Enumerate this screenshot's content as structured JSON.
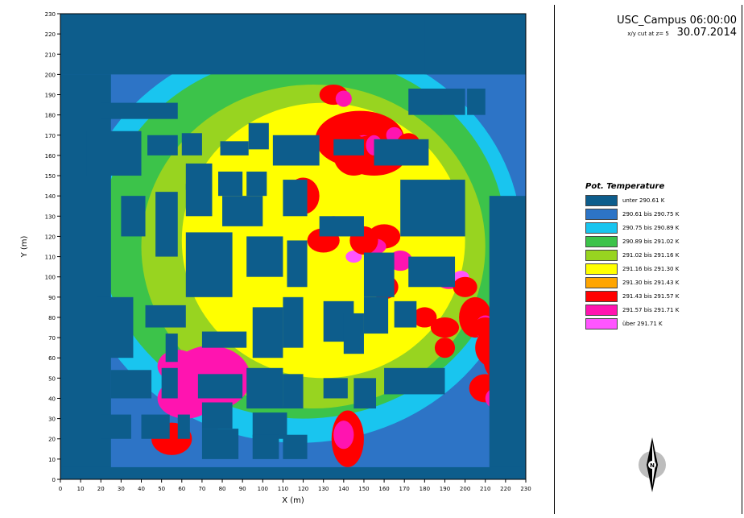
{
  "header": {
    "title": "USC_Campus 06:00:00 30.07.2014",
    "subtitle": "x/y cut at z= 5"
  },
  "legend": {
    "title": "Pot. Temperature",
    "items": [
      {
        "label": "unter 290.61 K",
        "color": "#0d5d8c"
      },
      {
        "label": "290.61 bis 290.75 K",
        "color": "#2d74c6"
      },
      {
        "label": "290.75 bis 290.89 K",
        "color": "#19c5ef"
      },
      {
        "label": "290.89 bis 291.02 K",
        "color": "#3cc34a"
      },
      {
        "label": "291.02 bis 291.16 K",
        "color": "#98d420"
      },
      {
        "label": "291.16 bis 291.30 K",
        "color": "#ffff00"
      },
      {
        "label": "291.30 bis 291.43 K",
        "color": "#ffa500"
      },
      {
        "label": "291.43 bis 291.57 K",
        "color": "#ff0000"
      },
      {
        "label": "291.57 bis 291.71 K",
        "color": "#ff14b0"
      },
      {
        "label": "über 291.71 K",
        "color": "#ff55ff"
      }
    ]
  },
  "north_arrow": {
    "label": "N",
    "icon": "north-arrow-icon"
  },
  "chart_data": {
    "type": "heatmap",
    "title": "USC_Campus 06:00:00 30.07.2014",
    "subtitle": "x/y cut at z= 5",
    "xlabel": "X (m)",
    "ylabel": "Y (m)",
    "xlim": [
      0,
      230
    ],
    "ylim": [
      0,
      230
    ],
    "x_ticks": [
      0,
      10,
      20,
      30,
      40,
      50,
      60,
      70,
      80,
      90,
      100,
      110,
      120,
      130,
      140,
      150,
      160,
      170,
      180,
      190,
      200,
      210,
      220,
      230
    ],
    "y_ticks": [
      0,
      10,
      20,
      30,
      40,
      50,
      60,
      70,
      80,
      90,
      100,
      110,
      120,
      130,
      140,
      150,
      160,
      170,
      180,
      190,
      200,
      210,
      220,
      230
    ],
    "variable": "Pot. Temperature",
    "unit": "K",
    "grid": false,
    "legend_position": "right",
    "buildings": [
      [
        0,
        200,
        230,
        230
      ],
      [
        0,
        0,
        25,
        200
      ],
      [
        180,
        200,
        230,
        230
      ],
      [
        212,
        0,
        230,
        140
      ],
      [
        0,
        0,
        230,
        6
      ],
      [
        172,
        180,
        200,
        193
      ],
      [
        201,
        180,
        210,
        193
      ],
      [
        20,
        178,
        58,
        186
      ],
      [
        13,
        150,
        40,
        172
      ],
      [
        43,
        160,
        58,
        170
      ],
      [
        60,
        160,
        70,
        171
      ],
      [
        79,
        160,
        93,
        167
      ],
      [
        93,
        163,
        103,
        176
      ],
      [
        105,
        155,
        128,
        170
      ],
      [
        135,
        160,
        150,
        168
      ],
      [
        155,
        155,
        182,
        168
      ],
      [
        62,
        143,
        75,
        156
      ],
      [
        78,
        140,
        90,
        152
      ],
      [
        92,
        140,
        102,
        152
      ],
      [
        30,
        120,
        42,
        140
      ],
      [
        47,
        110,
        58,
        142
      ],
      [
        62,
        130,
        75,
        146
      ],
      [
        80,
        125,
        100,
        140
      ],
      [
        110,
        130,
        122,
        148
      ],
      [
        128,
        120,
        150,
        130
      ],
      [
        168,
        120,
        200,
        148
      ],
      [
        62,
        90,
        85,
        122
      ],
      [
        92,
        100,
        110,
        120
      ],
      [
        112,
        95,
        122,
        118
      ],
      [
        150,
        90,
        165,
        112
      ],
      [
        172,
        95,
        195,
        110
      ],
      [
        18,
        60,
        36,
        90
      ],
      [
        42,
        75,
        62,
        86
      ],
      [
        52,
        58,
        58,
        72
      ],
      [
        95,
        60,
        110,
        85
      ],
      [
        110,
        65,
        120,
        90
      ],
      [
        130,
        68,
        145,
        88
      ],
      [
        140,
        62,
        150,
        82
      ],
      [
        150,
        72,
        162,
        90
      ],
      [
        165,
        75,
        176,
        88
      ],
      [
        70,
        65,
        92,
        73
      ],
      [
        25,
        40,
        45,
        54
      ],
      [
        50,
        40,
        58,
        55
      ],
      [
        68,
        40,
        90,
        52
      ],
      [
        92,
        35,
        110,
        55
      ],
      [
        110,
        35,
        120,
        52
      ],
      [
        130,
        40,
        142,
        50
      ],
      [
        145,
        35,
        156,
        50
      ],
      [
        160,
        42,
        190,
        55
      ],
      [
        70,
        25,
        85,
        38
      ],
      [
        95,
        20,
        112,
        33
      ],
      [
        20,
        20,
        35,
        32
      ],
      [
        40,
        20,
        54,
        32
      ],
      [
        58,
        20,
        64,
        32
      ],
      [
        70,
        10,
        88,
        25
      ],
      [
        95,
        10,
        108,
        22
      ],
      [
        110,
        10,
        122,
        22
      ]
    ],
    "hot_spots": [
      [
        40,
        74,
        50,
        20,
        16,
        8
      ],
      [
        48,
        62,
        40,
        14,
        10,
        8
      ],
      [
        52,
        58,
        56,
        10,
        8,
        8
      ],
      [
        20,
        142,
        20,
        8,
        14,
        7
      ],
      [
        21,
        140,
        22,
        5,
        7,
        8
      ],
      [
        15,
        55,
        20,
        10,
        8,
        7
      ],
      [
        120,
        148,
        168,
        22,
        14,
        7
      ],
      [
        123,
        150,
        165,
        6,
        5,
        8
      ],
      [
        112,
        145,
        160,
        10,
        10,
        7
      ],
      [
        150,
        155,
        160,
        16,
        10,
        7
      ],
      [
        156,
        155,
        165,
        4,
        5,
        8
      ],
      [
        162,
        188,
        185,
        6,
        5,
        7
      ],
      [
        162,
        187,
        183,
        3,
        3,
        8
      ],
      [
        102,
        135,
        190,
        7,
        5,
        7
      ],
      [
        108,
        140,
        188,
        4,
        4,
        8
      ],
      [
        145,
        120,
        140,
        8,
        9,
        7
      ],
      [
        145,
        135,
        125,
        5,
        5,
        8
      ],
      [
        140,
        130,
        118,
        8,
        6,
        7
      ],
      [
        175,
        160,
        120,
        8,
        6,
        7
      ],
      [
        185,
        155,
        115,
        6,
        4,
        8
      ],
      [
        192,
        145,
        110,
        4,
        3,
        9
      ],
      [
        200,
        168,
        108,
        6,
        5,
        8
      ],
      [
        196,
        150,
        118,
        7,
        7,
        7
      ],
      [
        190,
        165,
        170,
        4,
        4,
        8
      ],
      [
        180,
        172,
        165,
        6,
        6,
        7
      ],
      [
        170,
        160,
        95,
        7,
        6,
        7
      ],
      [
        220,
        192,
        98,
        6,
        4,
        8
      ],
      [
        230,
        198,
        100,
        4,
        3,
        9
      ],
      [
        155,
        200,
        95,
        6,
        5,
        7
      ],
      [
        158,
        205,
        80,
        8,
        10,
        7
      ],
      [
        160,
        210,
        75,
        5,
        6,
        8
      ],
      [
        160,
        215,
        60,
        6,
        10,
        7
      ],
      [
        165,
        220,
        65,
        4,
        5,
        8
      ],
      [
        180,
        240,
        55,
        4,
        5,
        9
      ],
      [
        95,
        210,
        45,
        8,
        7,
        7
      ],
      [
        98,
        215,
        40,
        5,
        5,
        8
      ],
      [
        98,
        222,
        38,
        3,
        3,
        9
      ],
      [
        90,
        230,
        30,
        6,
        4,
        7
      ],
      [
        120,
        220,
        30,
        5,
        6,
        7
      ],
      [
        98,
        235,
        20,
        3,
        4,
        7
      ],
      [
        140,
        215,
        65,
        10,
        10,
        7
      ],
      [
        130,
        230,
        65,
        6,
        6,
        7
      ],
      [
        155,
        230,
        52,
        6,
        5,
        7
      ],
      [
        130,
        180,
        80,
        6,
        5,
        7
      ],
      [
        100,
        190,
        75,
        7,
        5,
        7
      ],
      [
        80,
        190,
        65,
        5,
        5,
        7
      ],
      [
        20,
        210,
        75,
        6,
        5,
        7
      ]
    ]
  }
}
